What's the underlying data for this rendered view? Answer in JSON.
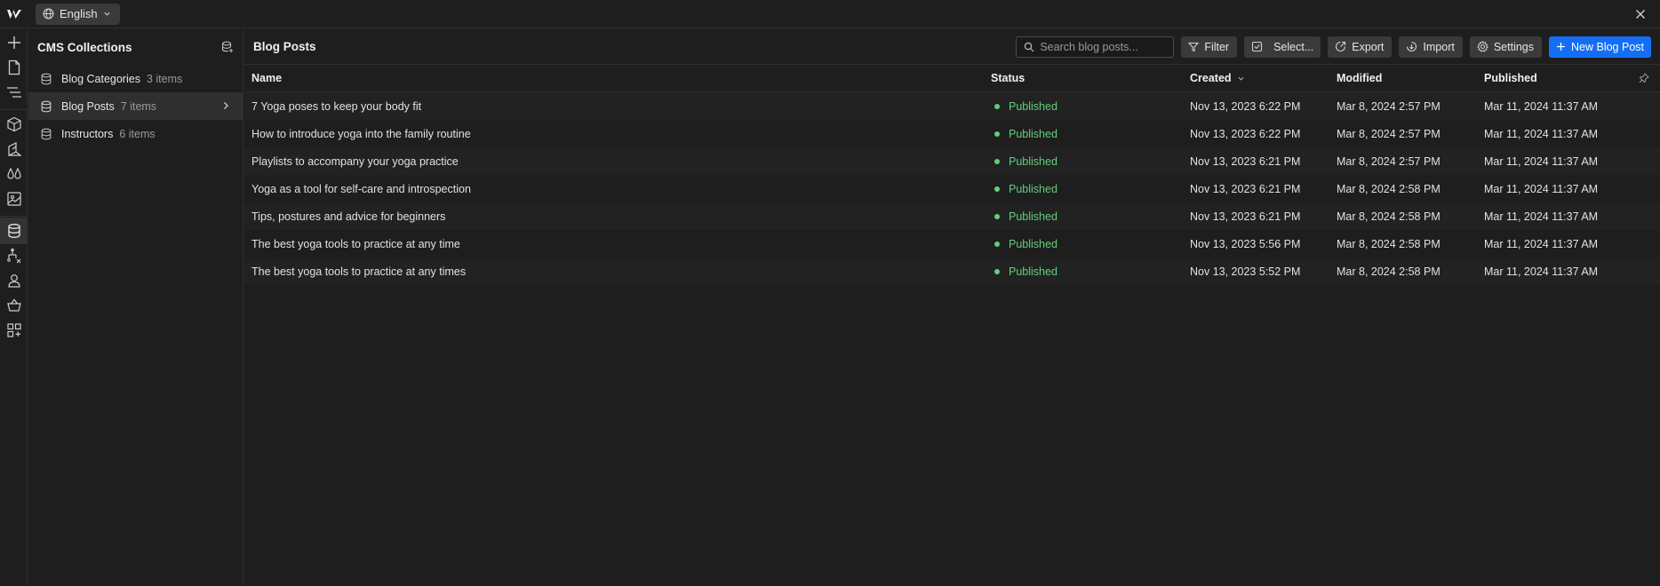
{
  "topbar": {
    "language": "English"
  },
  "cms": {
    "title": "CMS Collections",
    "collections": [
      {
        "name": "Blog Categories",
        "count": "3 items"
      },
      {
        "name": "Blog Posts",
        "count": "7 items"
      },
      {
        "name": "Instructors",
        "count": "6 items"
      }
    ]
  },
  "main": {
    "title": "Blog Posts",
    "search_placeholder": "Search blog posts...",
    "buttons": {
      "filter": "Filter",
      "select": "Select...",
      "export": "Export",
      "import": "Import",
      "settings": "Settings",
      "new_post": "New Blog Post"
    },
    "columns": {
      "name": "Name",
      "status": "Status",
      "created": "Created",
      "modified": "Modified",
      "published": "Published"
    },
    "rows": [
      {
        "name": "7 Yoga poses to keep your body fit",
        "status": "Published",
        "created": "Nov 13, 2023 6:22 PM",
        "modified": "Mar 8, 2024 2:57 PM",
        "published": "Mar 11, 2024 11:37 AM"
      },
      {
        "name": "How to introduce yoga into the family routine",
        "status": "Published",
        "created": "Nov 13, 2023 6:22 PM",
        "modified": "Mar 8, 2024 2:57 PM",
        "published": "Mar 11, 2024 11:37 AM"
      },
      {
        "name": "Playlists to accompany your yoga practice",
        "status": "Published",
        "created": "Nov 13, 2023 6:21 PM",
        "modified": "Mar 8, 2024 2:57 PM",
        "published": "Mar 11, 2024 11:37 AM"
      },
      {
        "name": "Yoga as a tool for self-care and introspection",
        "status": "Published",
        "created": "Nov 13, 2023 6:21 PM",
        "modified": "Mar 8, 2024 2:58 PM",
        "published": "Mar 11, 2024 11:37 AM"
      },
      {
        "name": "Tips, postures and advice for beginners",
        "status": "Published",
        "created": "Nov 13, 2023 6:21 PM",
        "modified": "Mar 8, 2024 2:58 PM",
        "published": "Mar 11, 2024 11:37 AM"
      },
      {
        "name": "The best yoga tools to practice at any time",
        "status": "Published",
        "created": "Nov 13, 2023 5:56 PM",
        "modified": "Mar 8, 2024 2:58 PM",
        "published": "Mar 11, 2024 11:37 AM"
      },
      {
        "name": "The best yoga tools to practice at any times",
        "status": "Published",
        "created": "Nov 13, 2023 5:52 PM",
        "modified": "Mar 8, 2024 2:58 PM",
        "published": "Mar 11, 2024 11:37 AM"
      }
    ]
  },
  "colors": {
    "accent": "#146ef5",
    "published": "#5fd07a",
    "background": "#1e1e1e"
  }
}
